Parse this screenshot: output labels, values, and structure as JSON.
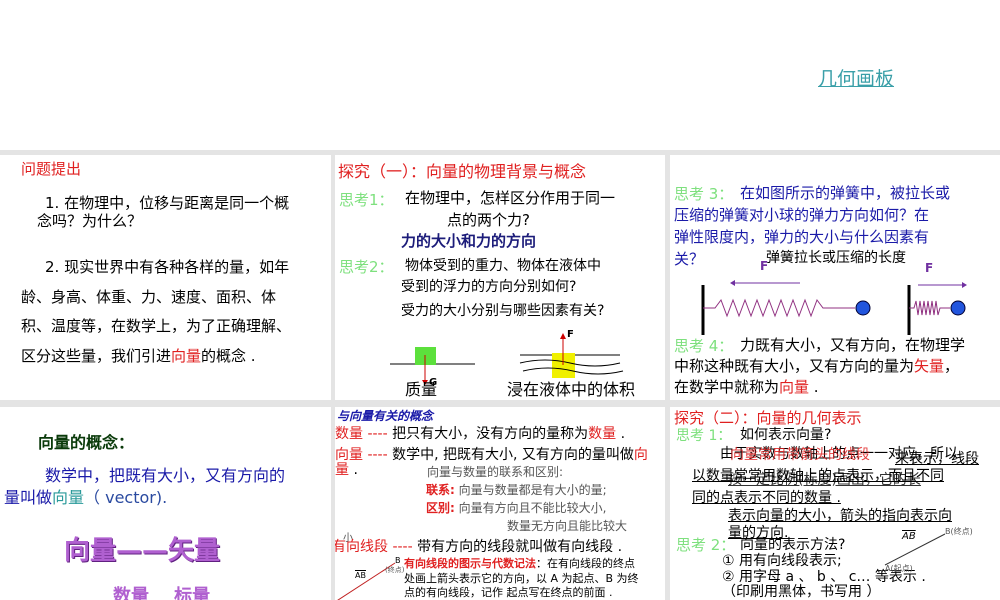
{
  "header": {
    "link": "几何画板"
  },
  "slide1": {
    "title": "问题提出",
    "q1a": "1. 在物理中，位移与距离是同一个概",
    "q1b": "念吗？为什么？",
    "q2a": "2. 现实世界中有各种各样的量，如年",
    "q2b": "龄、身高、体重、力、速度、面积、体",
    "q2c": "积、温度等，在数学上，为了正确理解、",
    "q2d_pre": "区分这些量，我们引进",
    "q2d_red": "向量",
    "q2d_post": "的概念 ."
  },
  "slide2": {
    "title": "探究（一）：向量的物理背景与概念",
    "t1": "思考1：",
    "q1a": "在物理中，怎样区分作用于同一",
    "q1b": "点的两个力?",
    "a1": "力的大小和力的方向",
    "t2": "思考2：",
    "q2a": "物体受到的重力、物体在液体中",
    "q2b": "受到的浮力的方向分别如何?",
    "q2c": "受力的大小分别与哪些因素有关?",
    "label_g": "G",
    "label_f": "F",
    "cap1": "质量",
    "cap2": "浸在液体中的体积"
  },
  "slide3": {
    "t3": "思考 3：",
    "q3a": "在如图所示的弹簧中，被拉长或",
    "q3b": "压缩的弹簧对小球的弹力方向如何？在",
    "q3c": "弹性限度内，弹力的大小与什么因素有",
    "q3d": "关？",
    "ans": "弹簧拉长或压缩的长度",
    "f1": "F",
    "f2": "F",
    "t4": "思考 4：",
    "q4a": "力既有大小，又有方向，在物理学",
    "q4b_pre": "中称这种既有大小，又有方向的量为",
    "q4b_red": "矢量",
    "q4b_post": "，",
    "q4c_pre": "在数学中就称为",
    "q4c_red": "向量",
    "q4c_post": " ."
  },
  "slide4": {
    "title": "向量的概念：",
    "d1": "数学中，把既有大小，又有方向的",
    "d2_pre": "量叫做",
    "d2_hl": "向量",
    "d2_post": "（ vector).",
    "art": "向量——矢量",
    "art2": "数量    标量"
  },
  "slide5": {
    "title": "与向量有关的概念",
    "l1_red": "数量 ----",
    "l1": " 把只有大小，没有方向的量称为",
    "l1_red2": "数量",
    "l1_end": " .",
    "l2_red": "向量 ----",
    "l2": " 数学中, 把既有大小, 又有方向的量叫做",
    "l2_red2": "向",
    "l2b_red": "量",
    "l2b": " .",
    "rel": "向量与数量的联系和区别:",
    "lx": "联系:",
    "lx_t": "向量与数量都是有大小的量;",
    "qb": "区别:",
    "qb_t": "向量有方向且不能比较大小,",
    "qb_t2": "数量无方向且能比较大",
    "qb_t3": "小",
    "l3_red": "有向线段 ----",
    "l3": " 带有方向的线段就叫做有向线段 .",
    "n_red": "有向线段的图示与代数记法",
    "n1": "：在有向线段的终点",
    "n2": "处画上箭头表示它的方向，以 A 为起点、B 为终",
    "n3": "点的有向线段，记作 起点写在终点的前面 .",
    "ab": "AB",
    "b": "B",
    "bz": "(终点)"
  },
  "slide6": {
    "title": "探究（二）：向量的几何表示",
    "t1": "思考 1：",
    "q1": "如何表示向量?",
    "o1": "由于实数与数轴上的点一一对应，所以",
    "o1_red": "向量常用带箭头的线段",
    "o1b": "来表示，线段",
    "o2": "以数量常常用数轴上的点表示，而且不同",
    "o2b": "按一定比例(标度)画出，它的长",
    "o3": "同的点表示不同的数量 .",
    "o4": "表示向量的大小，箭头的指向表示向",
    "o5": "量的方向.",
    "t2": "思考 2：",
    "q2": "向量的表示方法?",
    "m1": "① 用有向线段表示;",
    "m2": "② 用字母 a 、 b 、 c… 等表示 .",
    "m3": "（印刷用黑体，书写用       ）",
    "ab": "AB",
    "b": "B(终点)",
    "a": "A(起点)"
  }
}
